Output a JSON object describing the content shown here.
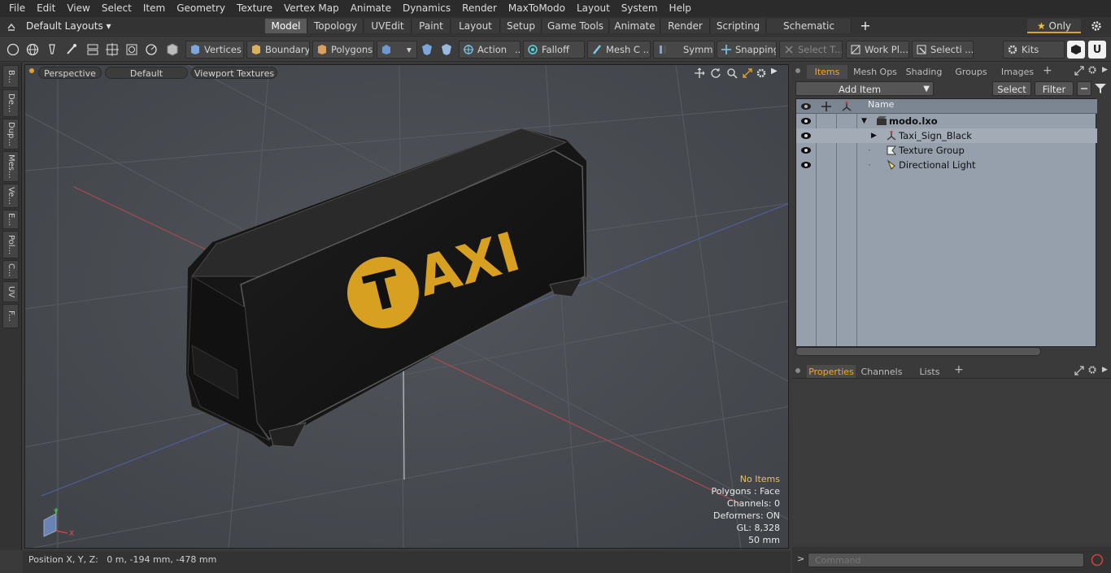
{
  "menubar": [
    "File",
    "Edit",
    "View",
    "Select",
    "Item",
    "Geometry",
    "Texture",
    "Vertex Map",
    "Animate",
    "Dynamics",
    "Render",
    "MaxToModo",
    "Layout",
    "System",
    "Help"
  ],
  "layouts": {
    "selector": "Default Layouts",
    "tabs": [
      "Model",
      "Topology",
      "UVEdit",
      "Paint",
      "Layout",
      "Setup",
      "Game Tools",
      "Animate",
      "Render",
      "Scripting",
      "Schematic Fusion"
    ],
    "active_tab": "Model",
    "only_label": "Only"
  },
  "toolbar": {
    "vertices": "Vertices",
    "boundary": "Boundary",
    "polygons": "Polygons",
    "action": "Action",
    "falloff": "Falloff",
    "mesh": "Mesh C ...",
    "symmetry": "Symm ...",
    "snapping": "Snapping",
    "select_t": "Select T...",
    "work_plane": "Work Pl...",
    "selection": "Selecti ...",
    "kits": "Kits"
  },
  "left_tabs": [
    "B...",
    "De...",
    "Dup...",
    "Mes...",
    "Ve...",
    "E...",
    "Pol...",
    "C...",
    "UV",
    "F..."
  ],
  "viewport": {
    "view_mode": "Perspective",
    "shading": "Default",
    "textures": "Viewport Textures",
    "sign_text": "TAXI",
    "sign_circle_letter": "T",
    "sign_letters": "AXI",
    "axis": {
      "x": "X",
      "y": "Y"
    },
    "hud": {
      "items": "No Items",
      "polygons": "Polygons : Face",
      "channels": "Channels: 0",
      "deformers": "Deformers: ON",
      "gl": "GL: 8,328",
      "scale": "50 mm"
    },
    "colors": {
      "bg": "#484c52",
      "hud_accent": "#f2c14e",
      "sign_yellow": "#d8a020"
    }
  },
  "status": {
    "position": "Position X, Y, Z:   0 m, -194 mm, -478 mm"
  },
  "items_panel": {
    "tabs": [
      "Items",
      "Mesh Ops",
      "Shading",
      "Groups",
      "Images"
    ],
    "active_tab": "Items",
    "add_item": "Add Item",
    "select": "Select",
    "filter": "Filter",
    "column_name": "Name",
    "rows": [
      {
        "label": "modo.lxo",
        "bold": true
      },
      {
        "label": "Taxi_Sign_Black",
        "bold": false
      },
      {
        "label": "Texture Group",
        "bold": false
      },
      {
        "label": "Directional Light",
        "bold": false
      }
    ]
  },
  "properties_panel": {
    "tabs": [
      "Properties",
      "Channels",
      "Lists"
    ],
    "active_tab": "Properties"
  },
  "command": {
    "placeholder": "Command"
  }
}
